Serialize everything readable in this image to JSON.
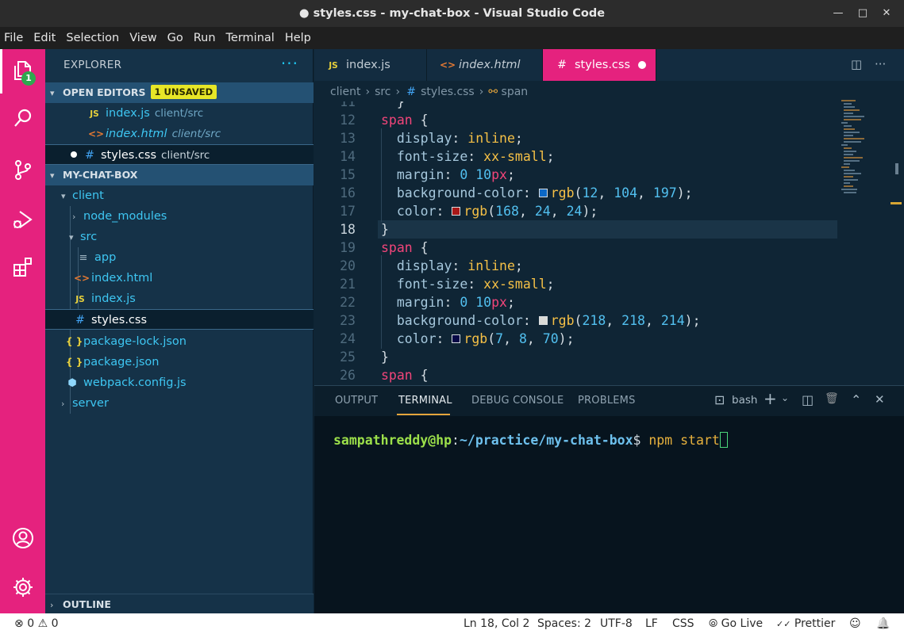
{
  "window": {
    "title": "● styles.css - my-chat-box - Visual Studio Code",
    "minimize": "—",
    "maximize": "□",
    "close": "✕"
  },
  "menu": [
    "File",
    "Edit",
    "Selection",
    "View",
    "Go",
    "Run",
    "Terminal",
    "Help"
  ],
  "activity_bar": {
    "items": [
      "explorer-icon",
      "search-icon",
      "source-control-icon",
      "run-debug-icon",
      "extensions-icon",
      "account-icon",
      "gear-icon"
    ],
    "badge": "1",
    "accent": "#e5227e"
  },
  "sidebar": {
    "title": "EXPLORER",
    "more": "···",
    "open_editors": {
      "label": "OPEN EDITORS",
      "badge": "1 UNSAVED",
      "items": [
        {
          "name": "index.js",
          "desc": "client/src"
        },
        {
          "name": "index.html",
          "desc": "client/src"
        },
        {
          "name": "styles.css",
          "desc": "client/src"
        }
      ]
    },
    "project": {
      "label": "MY-CHAT-BOX",
      "tree": [
        {
          "name": "client"
        },
        {
          "name": "node_modules"
        },
        {
          "name": "src"
        },
        {
          "name": "app"
        },
        {
          "name": "index.html"
        },
        {
          "name": "index.js"
        },
        {
          "name": "styles.css"
        },
        {
          "name": "package-lock.json"
        },
        {
          "name": "package.json"
        },
        {
          "name": "webpack.config.js"
        },
        {
          "name": "server"
        }
      ]
    },
    "outline": "OUTLINE",
    "icons": {
      "js": "JS",
      "html": "<>",
      "css": "#",
      "json": "{ }",
      "lines": "≡",
      "webpack": "⬢"
    }
  },
  "editor": {
    "tabs": [
      {
        "label": "index.js"
      },
      {
        "label": "index.html"
      },
      {
        "label": "styles.css"
      }
    ],
    "actions": {
      "split": "◫",
      "more": "···"
    },
    "breadcrumb": [
      "client",
      "src",
      "styles.css",
      "span"
    ],
    "breadcrumb_sep": "›",
    "cursor_line": "18",
    "code": [
      {
        "n": "11",
        "t": "  }"
      },
      {
        "n": "12",
        "sel": "span",
        "brace": " {"
      },
      {
        "n": "13",
        "prop": "display",
        "val": "inline"
      },
      {
        "n": "14",
        "prop": "font-size",
        "val": "xx-small"
      },
      {
        "n": "15",
        "prop": "margin",
        "v1": "0",
        "v2": "10",
        "unit": "px"
      },
      {
        "n": "16",
        "prop": "background-color",
        "color": "#0c68c5",
        "fn": "rgb",
        "args": [
          "12",
          "104",
          "197"
        ]
      },
      {
        "n": "17",
        "prop": "color",
        "color": "#a81818",
        "fn": "rgb",
        "args": [
          "168",
          "24",
          "24"
        ]
      },
      {
        "n": "18",
        "t": "}"
      },
      {
        "n": "19",
        "sel": "span",
        "brace": " {"
      },
      {
        "n": "20",
        "prop": "display",
        "val": "inline"
      },
      {
        "n": "21",
        "prop": "font-size",
        "val": "xx-small"
      },
      {
        "n": "22",
        "prop": "margin",
        "v1": "0",
        "v2": "10",
        "unit": "px"
      },
      {
        "n": "23",
        "prop": "background-color",
        "color": "#dadad6",
        "fn": "rgb",
        "args": [
          "218",
          "218",
          "214"
        ]
      },
      {
        "n": "24",
        "prop": "color",
        "color": "#070846",
        "fn": "rgb",
        "args": [
          "7",
          "8",
          "70"
        ]
      },
      {
        "n": "25",
        "t": "}"
      },
      {
        "n": "26",
        "sel": "span",
        "brace": " {"
      }
    ]
  },
  "panel": {
    "tabs": [
      "OUTPUT",
      "TERMINAL",
      "DEBUG CONSOLE",
      "PROBLEMS"
    ],
    "active_tab": "TERMINAL",
    "shell": "bash",
    "actions": {
      "terminal": "⊡",
      "add": "+",
      "dropdown": "⌄",
      "split": "◫",
      "trash": "🗑",
      "maximize": "⌃",
      "close": "✕"
    },
    "terminal": {
      "user": "sampathreddy@hp",
      "colon": ":",
      "path": "~/practice/my-chat-box",
      "dollar": "$",
      "command": " npm start"
    }
  },
  "status_bar": {
    "errors": "0",
    "warnings": "0",
    "error_icon": "⊗",
    "warning_icon": "⚠",
    "position": "Ln 18, Col 2",
    "spaces": "Spaces: 2",
    "encoding": "UTF-8",
    "eol": "LF",
    "language": "CSS",
    "golive": "Go Live",
    "prettier": "Prettier",
    "golive_icon": "⦾",
    "prettier_icon": "✓✓",
    "feedback_icon": "☺",
    "bell_icon": "🔔"
  }
}
